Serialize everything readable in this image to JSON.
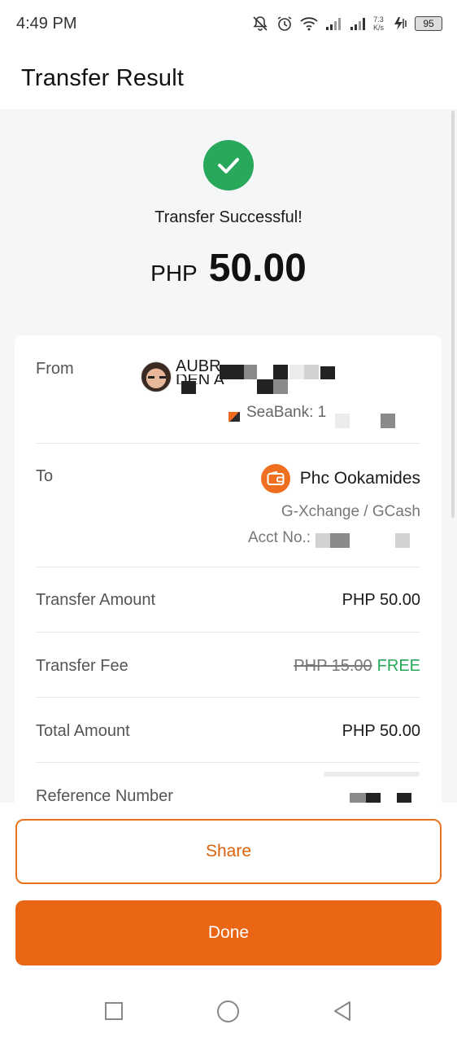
{
  "status_bar": {
    "time": "4:49 PM",
    "net_speed_value": "7.3",
    "net_speed_unit": "K/s",
    "battery": "95",
    "icons": [
      "mute-bell-icon",
      "alarm-icon",
      "wifi-icon",
      "signal-icon",
      "signal-icon",
      "hotspot-icon",
      "battery-icon"
    ]
  },
  "header": {
    "title": "Transfer Result"
  },
  "result": {
    "status_icon": "check-circle-icon",
    "status_color": "#27a85b",
    "message": "Transfer Successful!",
    "currency": "PHP",
    "amount": "50.00"
  },
  "details": {
    "from": {
      "label": "From",
      "name_line1": "AUBR",
      "name_line2": "DEN A",
      "bank": "SeaBank: 1"
    },
    "to": {
      "label": "To",
      "name": "Phc Ookamides",
      "bank": "G-Xchange / GCash",
      "acct_label": "Acct No.:"
    },
    "transfer_amount": {
      "label": "Transfer Amount",
      "value": "PHP 50.00"
    },
    "transfer_fee": {
      "label": "Transfer Fee",
      "original": "PHP 15.00",
      "value": "FREE"
    },
    "total_amount": {
      "label": "Total Amount",
      "value": "PHP 50.00"
    },
    "reference_number": {
      "label": "Reference Number"
    }
  },
  "actions": {
    "share_label": "Share",
    "done_label": "Done",
    "accent_color": "#ea6514"
  },
  "nav_bar": {
    "icons": [
      "recents-square-icon",
      "home-circle-icon",
      "back-triangle-icon"
    ]
  }
}
